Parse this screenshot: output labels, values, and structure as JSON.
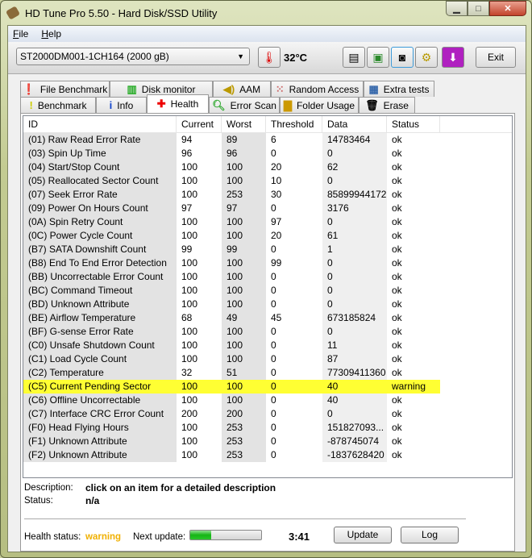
{
  "window": {
    "title": "HD Tune Pro 5.50 - Hard Disk/SSD Utility"
  },
  "menu": [
    {
      "key": "F",
      "rest": "ile"
    },
    {
      "key": "H",
      "rest": "elp"
    }
  ],
  "toolbar": {
    "drive": "ST2000DM001-1CH164 (2000 gB)",
    "temperature": "32°C",
    "exit_label": "Exit"
  },
  "tabs_row1": [
    {
      "label": "File Benchmark",
      "icon": "file-benchmark-icon"
    },
    {
      "label": "Disk monitor",
      "icon": "disk-monitor-icon"
    },
    {
      "label": "AAM",
      "icon": "speaker-icon"
    },
    {
      "label": "Random Access",
      "icon": "random-access-icon"
    },
    {
      "label": "Extra tests",
      "icon": "extra-tests-icon"
    }
  ],
  "tabs_row2": [
    {
      "label": "Benchmark",
      "icon": "exclamation-icon"
    },
    {
      "label": "Info",
      "icon": "info-icon"
    },
    {
      "label": "Health",
      "icon": "red-cross-icon"
    },
    {
      "label": "Error Scan",
      "icon": "magnifier-icon"
    },
    {
      "label": "Folder Usage",
      "icon": "folder-icon"
    },
    {
      "label": "Erase",
      "icon": "trash-icon"
    }
  ],
  "active_tab": "Health",
  "table": {
    "columns": [
      "ID",
      "Current",
      "Worst",
      "Threshold",
      "Data",
      "Status"
    ],
    "rows": [
      [
        "(01) Raw Read Error Rate",
        "94",
        "89",
        "6",
        "14783464",
        "ok"
      ],
      [
        "(03) Spin Up Time",
        "96",
        "96",
        "0",
        "0",
        "ok"
      ],
      [
        "(04) Start/Stop Count",
        "100",
        "100",
        "20",
        "62",
        "ok"
      ],
      [
        "(05) Reallocated Sector Count",
        "100",
        "100",
        "10",
        "0",
        "ok"
      ],
      [
        "(07) Seek Error Rate",
        "100",
        "253",
        "30",
        "85899944172",
        "ok"
      ],
      [
        "(09) Power On Hours Count",
        "97",
        "97",
        "0",
        "3176",
        "ok"
      ],
      [
        "(0A) Spin Retry Count",
        "100",
        "100",
        "97",
        "0",
        "ok"
      ],
      [
        "(0C) Power Cycle Count",
        "100",
        "100",
        "20",
        "61",
        "ok"
      ],
      [
        "(B7) SATA Downshift Count",
        "99",
        "99",
        "0",
        "1",
        "ok"
      ],
      [
        "(B8) End To End Error Detection",
        "100",
        "100",
        "99",
        "0",
        "ok"
      ],
      [
        "(BB) Uncorrectable Error Count",
        "100",
        "100",
        "0",
        "0",
        "ok"
      ],
      [
        "(BC) Command Timeout",
        "100",
        "100",
        "0",
        "0",
        "ok"
      ],
      [
        "(BD) Unknown Attribute",
        "100",
        "100",
        "0",
        "0",
        "ok"
      ],
      [
        "(BE) Airflow Temperature",
        "68",
        "49",
        "45",
        "673185824",
        "ok"
      ],
      [
        "(BF) G-sense Error Rate",
        "100",
        "100",
        "0",
        "0",
        "ok"
      ],
      [
        "(C0) Unsafe Shutdown Count",
        "100",
        "100",
        "0",
        "11",
        "ok"
      ],
      [
        "(C1) Load Cycle Count",
        "100",
        "100",
        "0",
        "87",
        "ok"
      ],
      [
        "(C2) Temperature",
        "32",
        "51",
        "0",
        "77309411360",
        "ok"
      ],
      [
        "(C5) Current Pending Sector",
        "100",
        "100",
        "0",
        "40",
        "warning"
      ],
      [
        "(C6) Offline Uncorrectable",
        "100",
        "100",
        "0",
        "40",
        "ok"
      ],
      [
        "(C7) Interface CRC Error Count",
        "200",
        "200",
        "0",
        "0",
        "ok"
      ],
      [
        "(F0) Head Flying Hours",
        "100",
        "253",
        "0",
        "151827093...",
        "ok"
      ],
      [
        "(F1) Unknown Attribute",
        "100",
        "253",
        "0",
        "-878745074",
        "ok"
      ],
      [
        "(F2) Unknown Attribute",
        "100",
        "253",
        "0",
        "-1837628420",
        "ok"
      ]
    ]
  },
  "details": {
    "description_label": "Description:",
    "description": "click on an item for a detailed description",
    "status_label": "Status:",
    "status": "n/a"
  },
  "footer": {
    "health_label": "Health status:",
    "health": "warning",
    "health_color": "#f0b000",
    "next_update_label": "Next update:",
    "progress_percent": 30,
    "countdown": "3:41",
    "update_label": "Update",
    "log_label": "Log"
  },
  "colors": {
    "warning_row": "#ffff33"
  }
}
